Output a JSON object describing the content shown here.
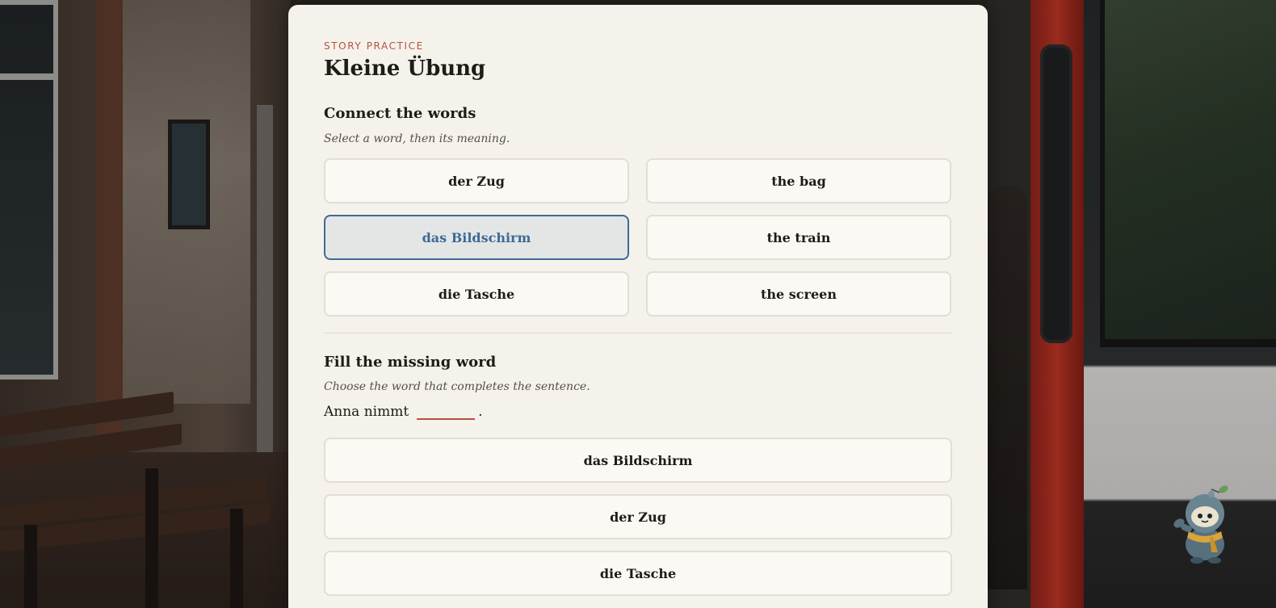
{
  "header": {
    "eyebrow": "STORY PRACTICE",
    "title": "Kleine Übung"
  },
  "matching": {
    "title": "Connect the words",
    "instruction": "Select a word, then its meaning.",
    "left_words": [
      "der Zug",
      "das Bildschirm",
      "die Tasche"
    ],
    "right_words": [
      "the bag",
      "the train",
      "the screen"
    ],
    "selected_left_index": 1
  },
  "fill": {
    "title": "Fill the missing word",
    "instruction": "Choose the word that completes the sentence.",
    "sentence_before": "Anna nimmt",
    "sentence_after": ".",
    "choices": [
      "das Bildschirm",
      "der Zug",
      "die Tasche"
    ]
  },
  "colors": {
    "accent": "#b5533c",
    "selected": "#3d6a96",
    "card_background": "#f5f2ec"
  },
  "mascot": {
    "icon": "robot-mascot-icon"
  }
}
